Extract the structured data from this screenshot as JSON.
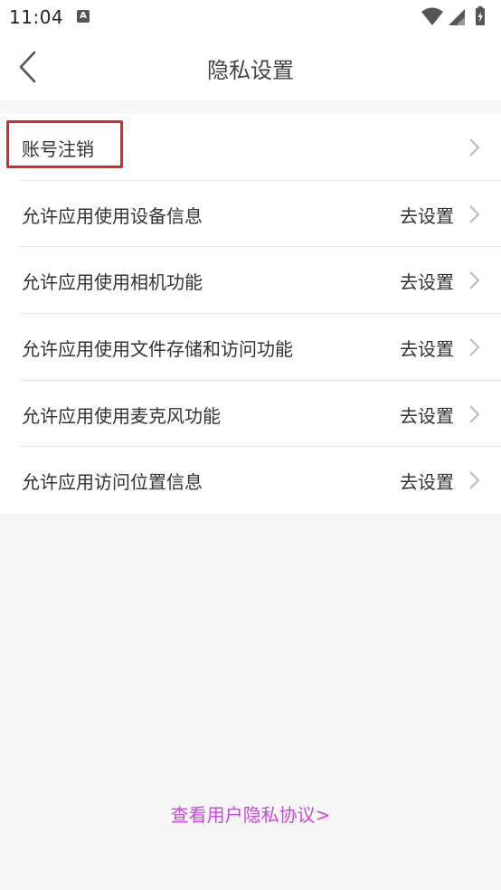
{
  "status_bar": {
    "time": "11:04",
    "notification_glyph": "A",
    "icons": [
      "wifi-icon",
      "signal-icon",
      "battery-charging-icon"
    ]
  },
  "header": {
    "title": "隐私设置",
    "back_icon": "chevron-left-icon"
  },
  "settings": {
    "items": [
      {
        "label": "账号注销",
        "action": ""
      },
      {
        "label": "允许应用使用设备信息",
        "action": "去设置"
      },
      {
        "label": "允许应用使用相机功能",
        "action": "去设置"
      },
      {
        "label": "允许应用使用文件存储和访问功能",
        "action": "去设置"
      },
      {
        "label": "允许应用使用麦克风功能",
        "action": "去设置"
      },
      {
        "label": "允许应用访问位置信息",
        "action": "去设置"
      }
    ]
  },
  "footer": {
    "link": "查看用户隐私协议>"
  },
  "colors": {
    "link": "#c44bd6",
    "highlight": "#e0282b",
    "background": "#f7f7f7"
  }
}
